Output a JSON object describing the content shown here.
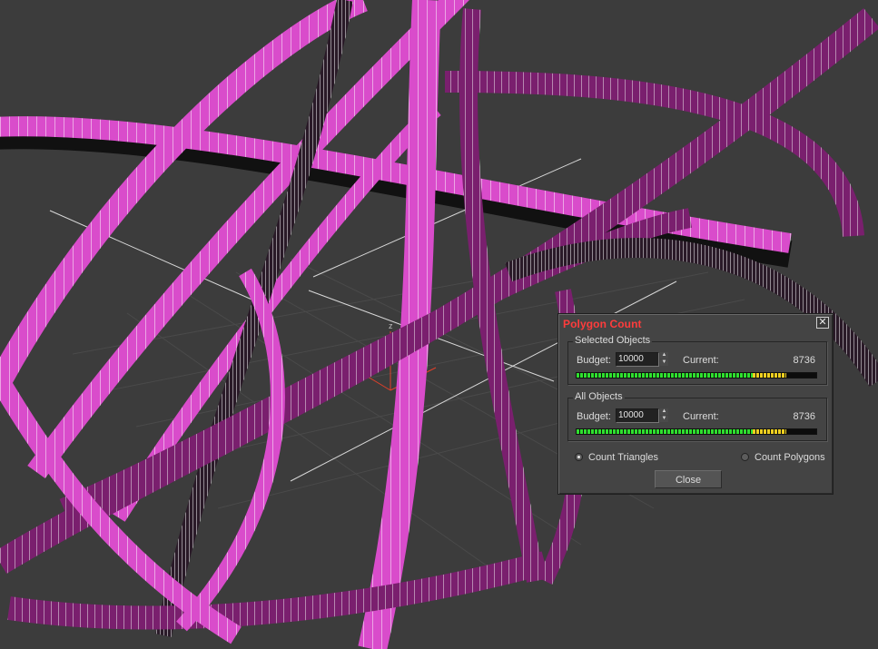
{
  "dialog": {
    "title": "Polygon Count",
    "close_icon": "close-icon",
    "selected_objects": {
      "label": "Selected Objects",
      "budget_label": "Budget:",
      "budget_value": "10000",
      "current_label": "Current:",
      "current_value": "8736",
      "meter_fraction": 0.8736
    },
    "all_objects": {
      "label": "All Objects",
      "budget_label": "Budget:",
      "budget_value": "10000",
      "current_label": "Current:",
      "current_value": "8736",
      "meter_fraction": 0.8736
    },
    "count_triangles_label": "Count Triangles",
    "count_triangles_checked": true,
    "count_polygons_label": "Count Polygons",
    "count_polygons_checked": false,
    "close_button_label": "Close"
  },
  "viewport": {
    "background_color": "#3c3c3c",
    "object_color": "#d23cc3",
    "axis_label": "z"
  },
  "colors": {
    "title": "#ff3c3c",
    "meter_green": "#2fe02f",
    "meter_yellow": "#f0d020"
  }
}
